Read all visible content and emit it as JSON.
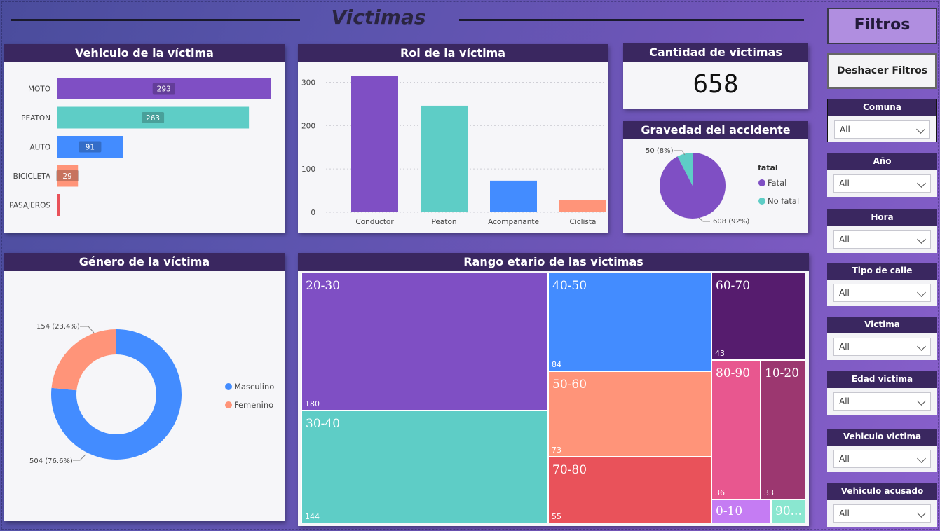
{
  "page": {
    "title": "Victimas"
  },
  "filters": {
    "title": "Filtros",
    "reset_label": "Deshacer Filtros",
    "slicers": [
      {
        "label": "Comuna",
        "value": "All"
      },
      {
        "label": "Año",
        "value": "All"
      },
      {
        "label": "Hora",
        "value": "All"
      },
      {
        "label": "Tipo de calle",
        "value": "All"
      },
      {
        "label": "Victima",
        "value": "All"
      },
      {
        "label": "Edad victima",
        "value": "All"
      },
      {
        "label": "Vehiculo victima",
        "value": "All"
      },
      {
        "label": "Vehiculo acusado",
        "value": "All"
      }
    ]
  },
  "cards": {
    "vehiculo": {
      "title": "Vehiculo de la víctima"
    },
    "rol": {
      "title": "Rol de la víctima"
    },
    "cantidad": {
      "title": "Cantidad de victimas",
      "value": "658"
    },
    "gravedad": {
      "title": "Gravedad del accidente"
    },
    "genero": {
      "title": "Género de la víctima"
    },
    "rango": {
      "title": "Rango etario de las victimas"
    }
  },
  "colors": {
    "purple": "#7f4fc4",
    "teal": "#5ecdc6",
    "blue": "#438cff",
    "salmon": "#ff9479",
    "red": "#e9525a",
    "darkpurple": "#561c6e",
    "pink": "#e8578f",
    "plum": "#9c3770",
    "lavender": "#c57cf3",
    "mint": "#8ae7d0"
  },
  "chart_data": [
    {
      "id": "vehiculo",
      "type": "bar",
      "orientation": "horizontal",
      "title": "Vehiculo de la víctima",
      "categories": [
        "MOTO",
        "PEATON",
        "AUTO",
        "BICICLETA",
        "PASAJEROS"
      ],
      "values": [
        293,
        263,
        91,
        29,
        4
      ],
      "data_labels": [
        "293",
        "263",
        "91",
        "29",
        ""
      ],
      "colors": [
        "#7f4fc4",
        "#5ecdc6",
        "#438cff",
        "#ff9479",
        "#e9525a"
      ],
      "xlim": [
        0,
        300
      ]
    },
    {
      "id": "rol",
      "type": "bar",
      "title": "Rol de la víctima",
      "categories": [
        "Conductor",
        "Peaton",
        "Acompañante",
        "Ciclista"
      ],
      "values": [
        315,
        246,
        73,
        29
      ],
      "colors": [
        "#7f4fc4",
        "#5ecdc6",
        "#438cff",
        "#ff9479"
      ],
      "ylim": [
        0,
        330
      ],
      "yticks": [
        0,
        100,
        200,
        300
      ],
      "grid": true
    },
    {
      "id": "gravedad",
      "type": "pie",
      "title": "Gravedad del accidente",
      "legend_title": "fatal",
      "legend_position": "right",
      "slices": [
        {
          "name": "Fatal",
          "value": 608,
          "label": "608 (92%)",
          "color": "#7f4fc4"
        },
        {
          "name": "No fatal",
          "value": 50,
          "label": "50 (8%)",
          "color": "#5ecdc6"
        }
      ]
    },
    {
      "id": "genero",
      "type": "pie",
      "variant": "donut",
      "title": "Género de la víctima",
      "legend_position": "right",
      "slices": [
        {
          "name": "Masculino",
          "value": 504,
          "label": "504 (76.6%)",
          "color": "#438cff"
        },
        {
          "name": "Femenino",
          "value": 154,
          "label": "154 (23.4%)",
          "color": "#ff9479"
        }
      ]
    },
    {
      "id": "rango",
      "type": "treemap",
      "title": "Rango etario de las victimas",
      "items": [
        {
          "label": "20-30",
          "value": 180,
          "color": "#7f4fc4"
        },
        {
          "label": "30-40",
          "value": 144,
          "color": "#5ecdc6"
        },
        {
          "label": "40-50",
          "value": 84,
          "color": "#438cff"
        },
        {
          "label": "50-60",
          "value": 73,
          "color": "#ff9479"
        },
        {
          "label": "70-80",
          "value": 55,
          "color": "#e9525a"
        },
        {
          "label": "60-70",
          "value": 43,
          "color": "#561c6e"
        },
        {
          "label": "80-90",
          "value": 36,
          "color": "#e8578f"
        },
        {
          "label": "10-20",
          "value": 33,
          "color": "#9c3770"
        },
        {
          "label": "0-10",
          "value": null,
          "color": "#c57cf3"
        },
        {
          "label": "90...",
          "value": null,
          "color": "#8ae7d0"
        }
      ]
    }
  ]
}
